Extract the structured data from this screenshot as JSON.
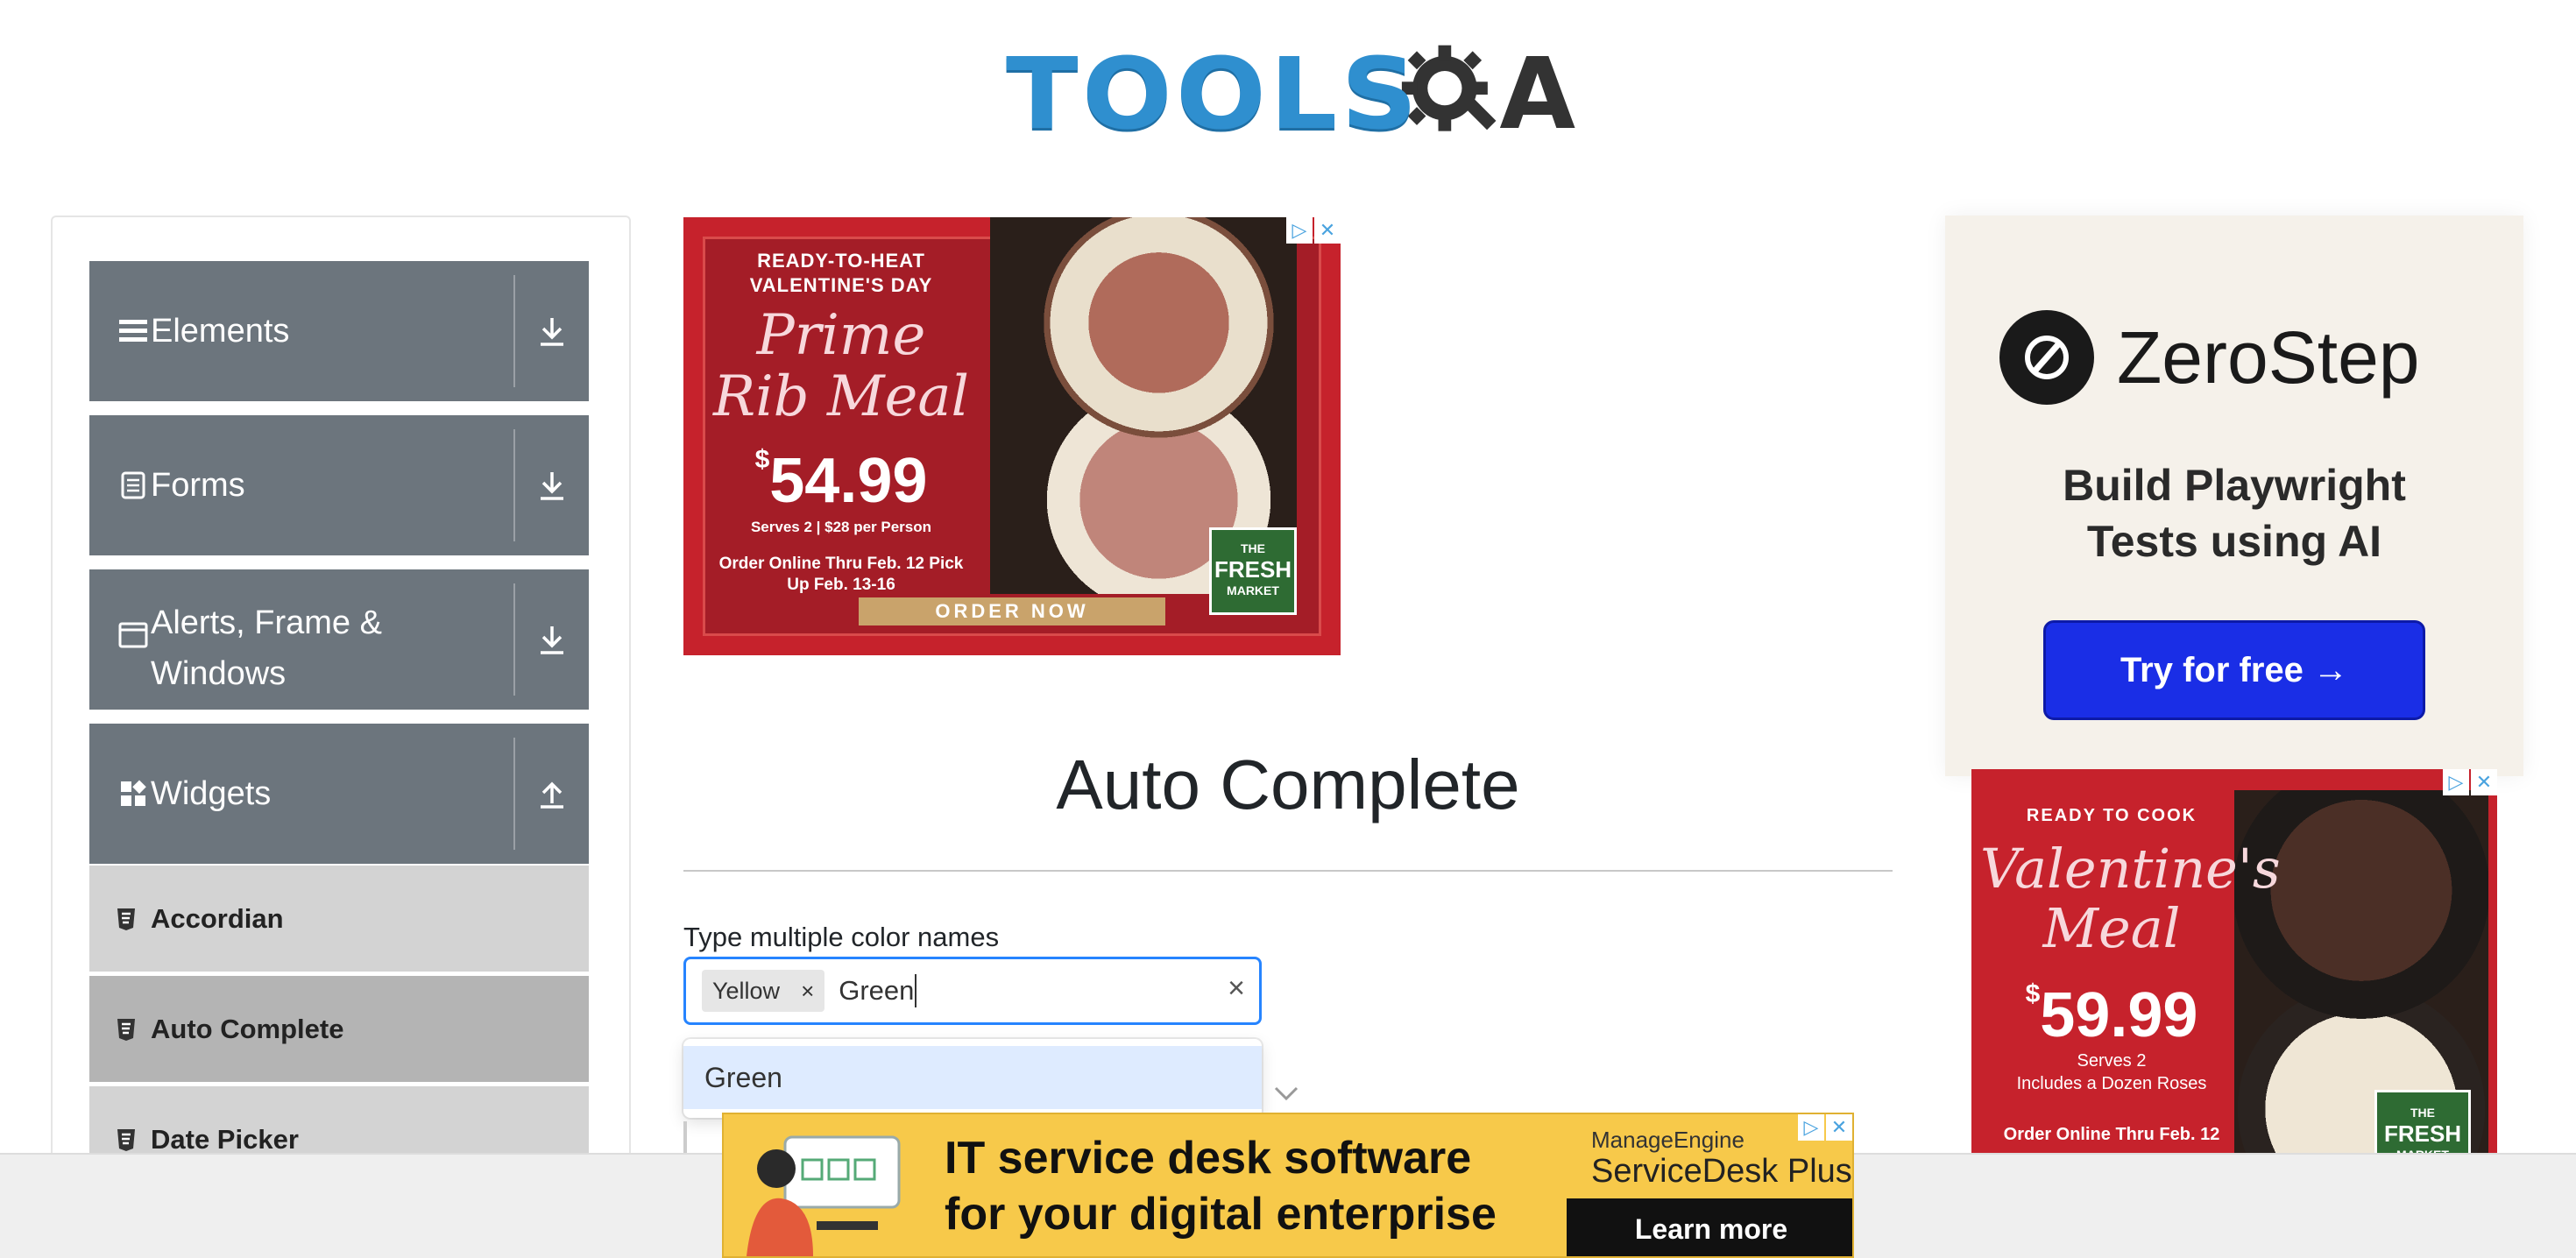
{
  "header": {
    "logo_text_left": "TOOLS",
    "logo_text_right": "A"
  },
  "sidebar": {
    "groups": [
      {
        "label": "Elements",
        "icon": "list-icon",
        "toggle": "download-icon"
      },
      {
        "label": "Forms",
        "icon": "document-icon",
        "toggle": "download-icon"
      },
      {
        "label": "Alerts, Frame & Windows",
        "icon": "window-icon",
        "toggle": "download-icon"
      },
      {
        "label": "Widgets",
        "icon": "widgets-icon",
        "toggle": "upload-icon"
      }
    ],
    "items": [
      {
        "label": "Accordian",
        "active": false
      },
      {
        "label": "Auto Complete",
        "active": true
      },
      {
        "label": "Date Picker",
        "active": false
      }
    ]
  },
  "main": {
    "title": "Auto Complete",
    "multi_label": "Type multiple color names",
    "chips": [
      {
        "label": "Yellow",
        "remove": "×"
      }
    ],
    "input_value": "Green",
    "clear_glyph": "×",
    "suggestions": [
      "Green"
    ]
  },
  "ads": {
    "top": {
      "kicker": "READY-TO-HEAT VALENTINE'S DAY",
      "headline": "Prime Rib Meal",
      "price_symbol": "$",
      "price": "54.99",
      "serves": "Serves 2 | $28 per Person",
      "order": "Order Online Thru Feb. 12 Pick Up Feb. 13-16",
      "badge_top": "THE",
      "badge_mid": "FRESH",
      "badge_bottom": "MARKET",
      "button": "ORDER NOW"
    },
    "zerostep": {
      "name": "ZeroStep",
      "tagline_1": "Build Playwright",
      "tagline_2": "Tests using AI",
      "button": "Try for free →"
    },
    "right_food": {
      "kicker": "READY TO COOK",
      "headline": "Valentine's Meal",
      "price_symbol": "$",
      "price": "59.99",
      "serves_1": "Serves 2",
      "serves_2": "Includes a Dozen Roses",
      "order": "Order Online Thru Feb. 12",
      "badge_top": "THE",
      "badge_mid": "FRESH",
      "badge_bottom": "MARKET"
    },
    "bottom": {
      "line1": "IT service desk software",
      "line2": "for your digital enterprise",
      "brand1": "ManageEngine",
      "brand2": "ServiceDesk Plus",
      "button": "Learn more"
    }
  },
  "colors": {
    "sidebar_group": "#6c757d",
    "sidebar_item": "#d3d3d3",
    "sidebar_item_active": "#b4b4b4",
    "focus": "#2684ff",
    "suggest_bg": "#deebff"
  }
}
